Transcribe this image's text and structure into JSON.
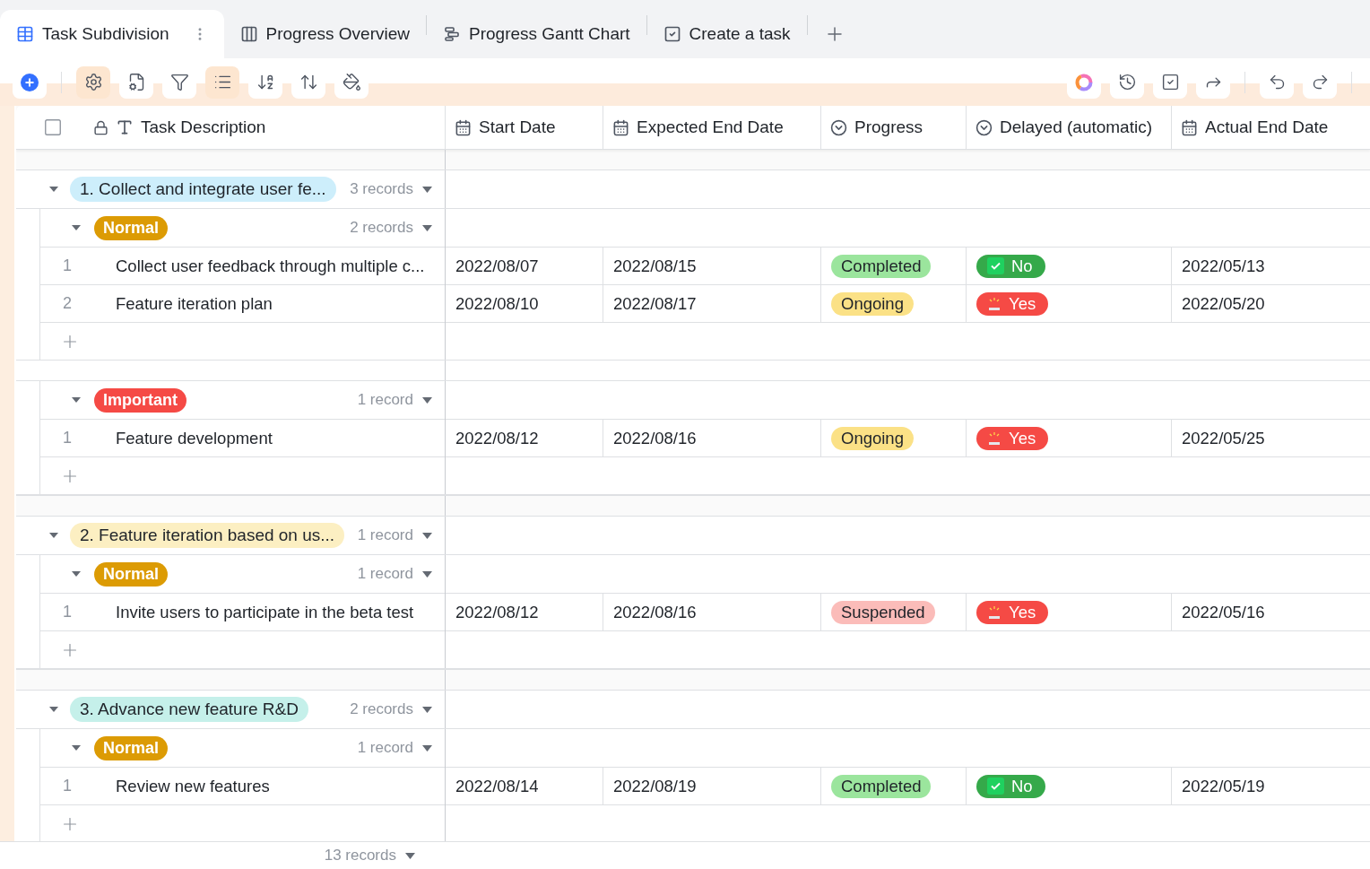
{
  "tabs": [
    {
      "label": "Task Subdivision",
      "kind": "table",
      "selected": true
    },
    {
      "label": "Progress Overview",
      "kind": "kanban",
      "selected": false
    },
    {
      "label": "Progress Gantt Chart",
      "kind": "gantt",
      "selected": false
    },
    {
      "label": "Create a task",
      "kind": "form",
      "selected": false
    }
  ],
  "toolbar": {
    "left": [
      {
        "kind": "add",
        "selected": false
      },
      {
        "kind": "settings",
        "selected": true
      },
      {
        "kind": "fields",
        "selected": false
      },
      {
        "kind": "filter",
        "selected": false
      },
      {
        "kind": "group",
        "selected": true
      },
      {
        "kind": "sort",
        "selected": false
      },
      {
        "kind": "height",
        "selected": false
      },
      {
        "kind": "color",
        "selected": false
      }
    ],
    "right": [
      {
        "kind": "ai"
      },
      {
        "kind": "history"
      },
      {
        "kind": "check"
      },
      {
        "kind": "share"
      },
      {
        "kind": "undo"
      },
      {
        "kind": "redo"
      }
    ]
  },
  "header_checkbox": {
    "checked": false
  },
  "columns": [
    {
      "label": "Task Description",
      "kind": "text"
    },
    {
      "label": "Start Date",
      "kind": "date"
    },
    {
      "label": "Expected End Date",
      "kind": "date"
    },
    {
      "label": "Progress",
      "kind": "select"
    },
    {
      "label": "Delayed (automatic)",
      "kind": "select"
    },
    {
      "label": "Actual End Date",
      "kind": "date"
    }
  ],
  "groups": [
    {
      "title": "1. Collect and integrate user fe...",
      "color": "#cdeefb",
      "count": "3 records",
      "expanded": true,
      "subgroups": [
        {
          "label": "Normal",
          "color": "#dc9b04",
          "count": "2 records",
          "expanded": true,
          "rows": [
            {
              "num": "1",
              "task": "Collect user feedback through multiple c...",
              "start": "2022/08/07",
              "expected": "2022/08/15",
              "progress": {
                "label": "Completed",
                "color": "#9be59d"
              },
              "delayed": {
                "label": "No",
                "late": false
              },
              "actual": "2022/05/13"
            },
            {
              "num": "2",
              "task": "Feature iteration plan",
              "start": "2022/08/10",
              "expected": "2022/08/17",
              "progress": {
                "label": "Ongoing",
                "color": "#fbe186"
              },
              "delayed": {
                "label": "Yes",
                "late": true
              },
              "actual": "2022/05/20"
            }
          ]
        },
        {
          "label": "Important",
          "color": "#f54a45",
          "count": "1 record",
          "expanded": true,
          "rows": [
            {
              "num": "1",
              "task": "Feature development",
              "start": "2022/08/12",
              "expected": "2022/08/16",
              "progress": {
                "label": "Ongoing",
                "color": "#fbe186"
              },
              "delayed": {
                "label": "Yes",
                "late": true
              },
              "actual": "2022/05/25"
            }
          ]
        }
      ]
    },
    {
      "title": "2. Feature iteration based on us...",
      "color": "#fcefc2",
      "count": "1 record",
      "expanded": true,
      "subgroups": [
        {
          "label": "Normal",
          "color": "#dc9b04",
          "count": "1 record",
          "expanded": true,
          "rows": [
            {
              "num": "1",
              "task": "Invite users to participate in the beta test",
              "start": "2022/08/12",
              "expected": "2022/08/16",
              "progress": {
                "label": "Suspended",
                "color": "#fbbcb9"
              },
              "delayed": {
                "label": "Yes",
                "late": true
              },
              "actual": "2022/05/16"
            }
          ]
        }
      ]
    },
    {
      "title": "3. Advance new feature R&D",
      "color": "#c5f0ea",
      "count": "2 records",
      "expanded": true,
      "subgroups": [
        {
          "label": "Normal",
          "color": "#dc9b04",
          "count": "1 record",
          "expanded": true,
          "rows": [
            {
              "num": "1",
              "task": "Review new features",
              "start": "2022/08/14",
              "expected": "2022/08/19",
              "progress": {
                "label": "Completed",
                "color": "#9be59d"
              },
              "delayed": {
                "label": "No",
                "late": false
              },
              "actual": "2022/05/19"
            }
          ]
        }
      ]
    }
  ],
  "footer": {
    "count": "13 records"
  }
}
